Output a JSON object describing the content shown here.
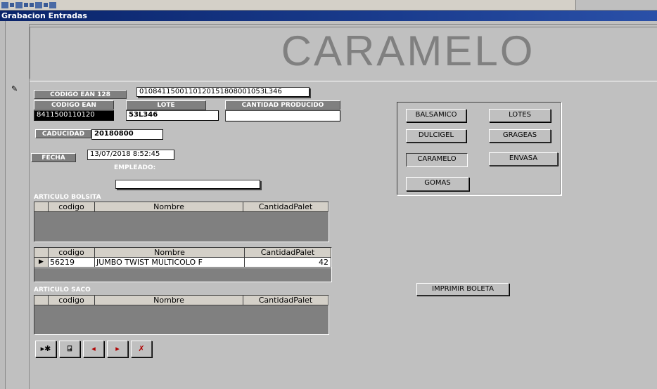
{
  "window": {
    "title": "Grabacion Entradas"
  },
  "header": {
    "title": "CARAMELO"
  },
  "record_selector_glyph": "✎",
  "fields": {
    "codigo_ean_128": {
      "label": "CODIGO EAN 128",
      "value": "0108411500110120151808001053L346"
    },
    "codigo_ean": {
      "label": "CODIGO EAN",
      "value": "8411500110120"
    },
    "lote": {
      "label": "LOTE",
      "value": "53L346"
    },
    "cantidad_producido": {
      "label": "CANTIDAD PRODUCIDO",
      "value": ""
    },
    "caducidad": {
      "label": "CADUCIDAD",
      "value": "20180800"
    },
    "fecha": {
      "label": "FECHA",
      "value": "13/07/2018 8:52:45"
    },
    "empleado": {
      "label": "EMPLEADO:",
      "value": ""
    }
  },
  "sections": {
    "bolsita": "ARTICULO BOLSITA",
    "saco": "ARTICULO SACO"
  },
  "grid_columns": [
    "codigo",
    "Nombre",
    "CantidadPalet"
  ],
  "grid_bolsita": {
    "rows": []
  },
  "grid_caja": {
    "rows": [
      {
        "selector": "▶",
        "codigo": "56219",
        "nombre": "JUMBO TWIST MULTICOLO F",
        "cantidad": "42"
      }
    ]
  },
  "grid_saco": {
    "rows": []
  },
  "category_buttons": {
    "balsamico": "BALSAMICO",
    "lotes": "LOTES",
    "dulcigel": "DULCIGEL",
    "grageas": "GRAGEAS",
    "caramelo": "CARAMELO",
    "envasa": "ENVASA",
    "gomas": "GOMAS"
  },
  "imprimir_boleta": "IMPRIMIR BOLETA",
  "nav_icons": [
    "new-record-icon",
    "exit-icon",
    "previous-icon",
    "next-icon",
    "delete-icon"
  ],
  "nav_glyphs": {
    "new": "▸✱",
    "exit": "⍈",
    "prev": "◂",
    "next": "▸",
    "delete": "✗"
  },
  "colors": {
    "title_bar": "#0a246a",
    "nav_red": "#b00000",
    "form_bg": "#c0c0c0"
  }
}
